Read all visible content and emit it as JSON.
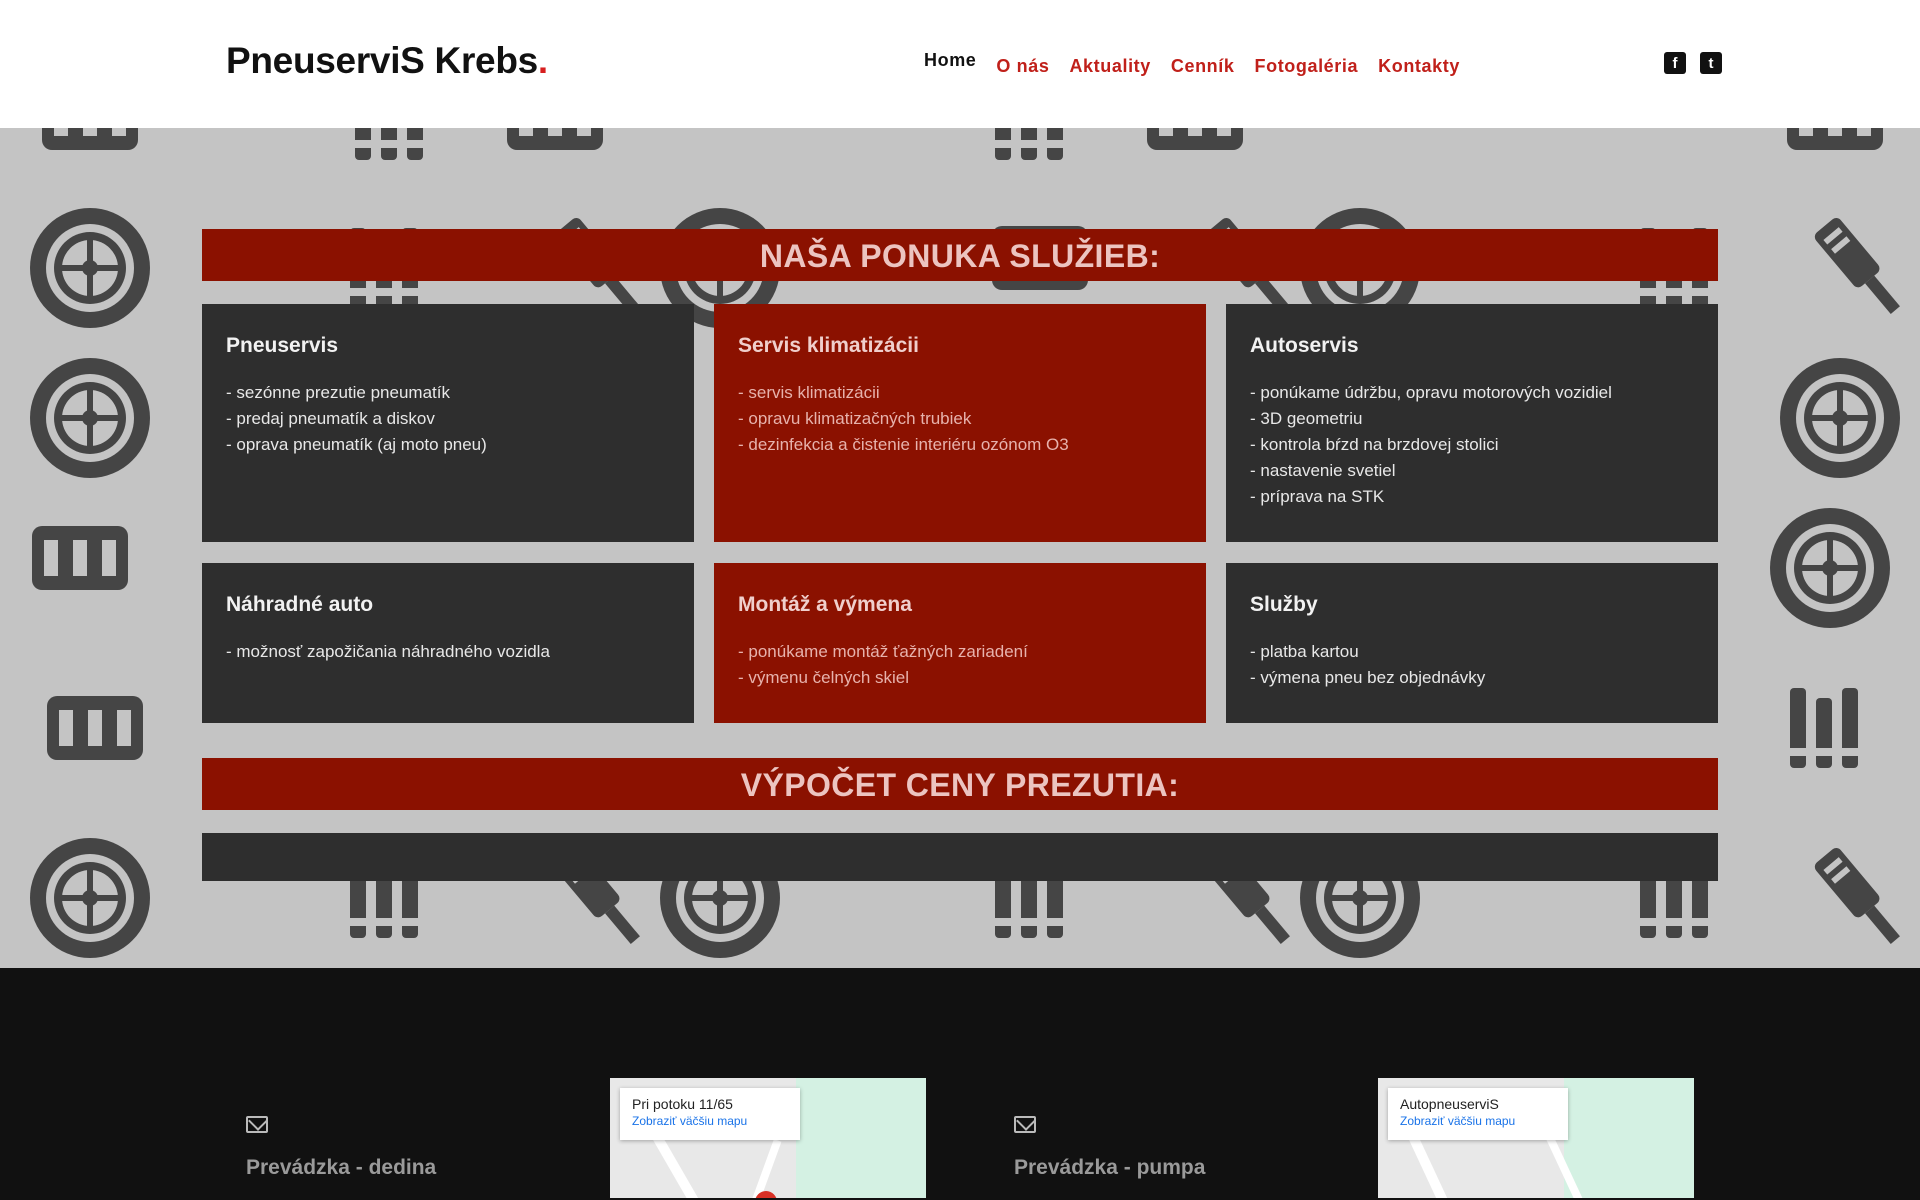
{
  "header": {
    "logo_text": "PneuserviS Krebs",
    "logo_dot": ".",
    "nav": [
      "Home",
      "O nás",
      "Aktuality",
      "Cenník",
      "Fotogaléria",
      "Kontakty"
    ],
    "social": [
      {
        "icon": "facebook-icon",
        "glyph": "f"
      },
      {
        "icon": "twitter-icon",
        "glyph": "t"
      }
    ]
  },
  "services": {
    "title": "NAŠA PONUKA SLUŽIEB:",
    "cards": [
      {
        "title": "Pneuservis",
        "style": "dark",
        "items": [
          "- sezónne prezutie pneumatík",
          "- predaj pneumatík a diskov",
          "- oprava pneumatík (aj moto pneu)"
        ]
      },
      {
        "title": "Servis klimatizácii",
        "style": "red",
        "items": [
          "- servis klimatizácii",
          "- opravu klimatizačných trubiek",
          "- dezinfekcia a čistenie interiéru ozónom O3"
        ]
      },
      {
        "title": "Autoservis",
        "style": "dark",
        "items": [
          "- ponúkame údržbu, opravu motorových vozidiel",
          "- 3D geometriu",
          "- kontrola bŕzd na brzdovej stolici",
          "- nastavenie svetiel",
          "- príprava na STK"
        ]
      },
      {
        "title": "Náhradné auto",
        "style": "dark",
        "items": [
          "- možnosť zapožičania náhradného vozidla"
        ]
      },
      {
        "title": "Montáž a výmena",
        "style": "red",
        "items": [
          "- ponúkame montáž ťažných zariadení",
          "- výmenu čelných skiel"
        ]
      },
      {
        "title": "Služby",
        "style": "dark",
        "items": [
          "- platba kartou",
          "- výmena pneu bez objednávky"
        ]
      }
    ]
  },
  "calc": {
    "title": "VÝPOČET CENY PREZUTIA:"
  },
  "footer": {
    "locations": [
      {
        "name": "Prevádzka - dedina",
        "map_title": "Pri potoku 11/65",
        "map_link": "Zobraziť väčšiu mapu"
      },
      {
        "name": "Prevádzka - pumpa",
        "map_title": "AutopneuserviS",
        "map_link": "Zobraziť väčšiu mapu"
      }
    ]
  },
  "colors": {
    "accent": "#8b1100",
    "dark_card": "#2e2e2e",
    "nav_red": "#c0201a",
    "pattern_bg": "#c4c4c4"
  }
}
